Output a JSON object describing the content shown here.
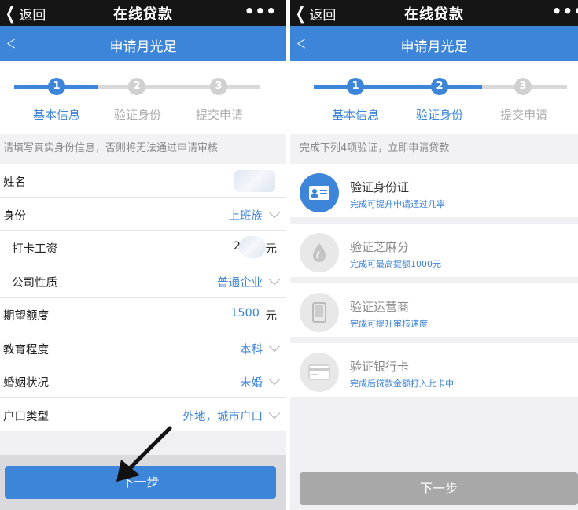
{
  "topbar": {
    "back_label": "返回",
    "title": "在线贷款",
    "more": "•••"
  },
  "bluebar": {
    "title": "申请月光足"
  },
  "steps": [
    {
      "num": "1",
      "label": "基本信息"
    },
    {
      "num": "2",
      "label": "验证身份"
    },
    {
      "num": "3",
      "label": "提交申请"
    }
  ],
  "left": {
    "notice": "请填写真实身份信息，否则将无法通过申请审核",
    "rows": [
      {
        "label": "姓名",
        "value": ""
      },
      {
        "label": "身份",
        "value": "上班族"
      },
      {
        "label": "打卡工资",
        "value": "2",
        "unit": "元"
      },
      {
        "label": "公司性质",
        "value": "普通企业"
      },
      {
        "label": "期望额度",
        "value": "1500",
        "unit": "元"
      },
      {
        "label": "教育程度",
        "value": "本科"
      },
      {
        "label": "婚姻状况",
        "value": "未婚"
      },
      {
        "label": "户口类型",
        "value": "外地，城市户口"
      }
    ],
    "next_button": "下一步"
  },
  "right": {
    "notice": "完成下列4项验证，立即申请贷款",
    "items": [
      {
        "title": "验证身份证",
        "sub": "完成可提升申请通过几率",
        "icon": "id-card-icon"
      },
      {
        "title": "验证芝麻分",
        "sub": "完成可最高提额1000元",
        "icon": "sesame-icon"
      },
      {
        "title": "验证运营商",
        "sub": "完成可提升审核速度",
        "icon": "phone-icon"
      },
      {
        "title": "验证银行卡",
        "sub": "完成后贷款金额打入此卡中",
        "icon": "bank-card-icon"
      }
    ],
    "next_button": "下一步"
  },
  "colors": {
    "primary": "#3d85d8",
    "topbar": "#151515",
    "disabled": "#a8a8a8"
  }
}
